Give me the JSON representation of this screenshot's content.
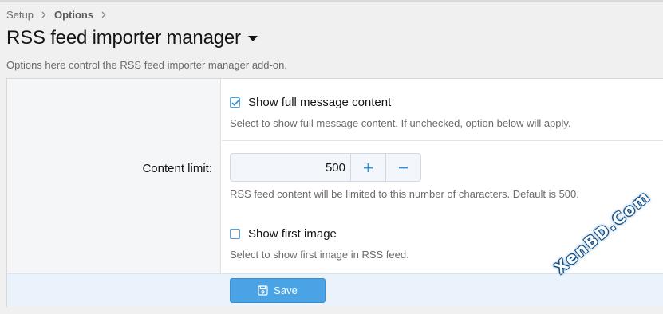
{
  "breadcrumb": {
    "items": [
      {
        "label": "Setup"
      },
      {
        "label": "Options"
      }
    ]
  },
  "page": {
    "title": "RSS feed importer manager",
    "description": "Options here control the RSS feed importer manager add-on."
  },
  "options": {
    "show_full": {
      "label": "Show full message content",
      "checked": true,
      "explain": "Select to show full message content. If unchecked, option below will apply."
    },
    "content_limit": {
      "label": "Content limit:",
      "value": "500",
      "increment_icon": "plus-icon",
      "decrement_icon": "minus-icon",
      "explain": "RSS feed content will be limited to this number of characters. Default is 500."
    },
    "show_first_image": {
      "label": "Show first image",
      "checked": false,
      "explain": "Select to show first image in RSS feed."
    }
  },
  "footer": {
    "save_label": "Save",
    "save_icon": "save-icon"
  },
  "watermark": {
    "text": "XenBD.Com"
  },
  "colors": {
    "accent": "#47a7eb",
    "button": "#4aa3e4",
    "footer_bg": "#eaf3fb"
  }
}
